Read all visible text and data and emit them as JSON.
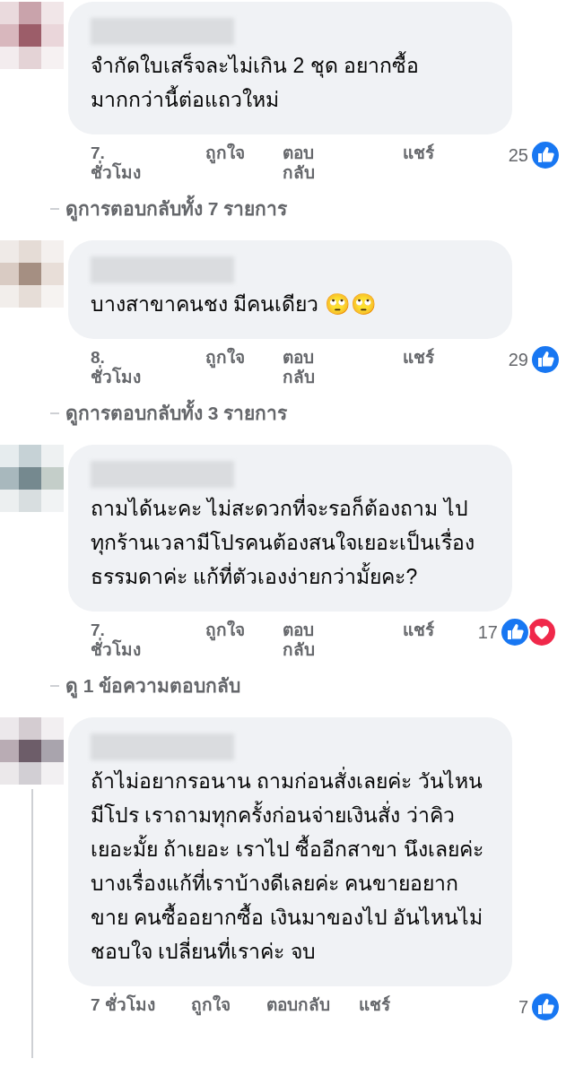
{
  "comments": [
    {
      "text": "จำกัดใบเสร็จละไม่เกิน 2 ชุด อยากซื้อมากกว่านี้ต่อแถวใหม่",
      "time": "7. ชั่วโมง",
      "meta_wrapped": true,
      "actions": [
        "ถูกใจ",
        "ตอบกลับ",
        "แชร์"
      ],
      "count": "25",
      "reactions": [
        {
          "kind": "like"
        }
      ],
      "replies_link": "ดูการตอบกลับทั้ง 7 รายการ"
    },
    {
      "text": "บางสาขาคนชง มีคนเดียว 🙄🙄",
      "time": "8. ชั่วโมง",
      "meta_wrapped": true,
      "actions": [
        "ถูกใจ",
        "ตอบกลับ",
        "แชร์"
      ],
      "count": "29",
      "reactions": [
        {
          "kind": "like"
        }
      ],
      "replies_link": "ดูการตอบกลับทั้ง 3 รายการ"
    },
    {
      "text": "ถามได้นะคะ ไม่สะดวกที่จะรอก็ต้องถาม ไปทุกร้านเวลามีโปรคนต้องสนใจเยอะเป็นเรื่องธรรมดาค่ะ แก้ที่ตัวเองง่ายกว่ามั้ยคะ?",
      "time": "7. ชั่วโมง",
      "meta_wrapped": true,
      "actions": [
        "ถูกใจ",
        "ตอบกลับ",
        "แชร์"
      ],
      "count": "17",
      "reactions": [
        {
          "kind": "like"
        },
        {
          "kind": "love"
        }
      ],
      "replies_link": "ดู 1 ข้อความตอบกลับ"
    },
    {
      "text": "ถ้าไม่อยากรอนาน ถามก่อนสั่งเลยค่ะ วันไหนมีโปร เราถามทุกครั้งก่อนจ่ายเงินสั่ง ว่าคิวเยอะมั้ย ถ้าเยอะ เราไป ซื้ออีกสาขา นึงเลยค่ะ บางเรื่องแก้ที่เราบ้างดีเลยค่ะ คนขายอยากขาย คนซื้ออยากซื้อ เงินมาของไป อันไหนไม่ชอบใจ เปลี่ยนที่เราค่ะ จบ",
      "time": "7 ชั่วโมง",
      "meta_wrapped": false,
      "actions": [
        "ถูกใจ",
        "ตอบกลับ",
        "แชร์"
      ],
      "count": "7",
      "reactions": [
        {
          "kind": "like"
        }
      ]
    }
  ]
}
